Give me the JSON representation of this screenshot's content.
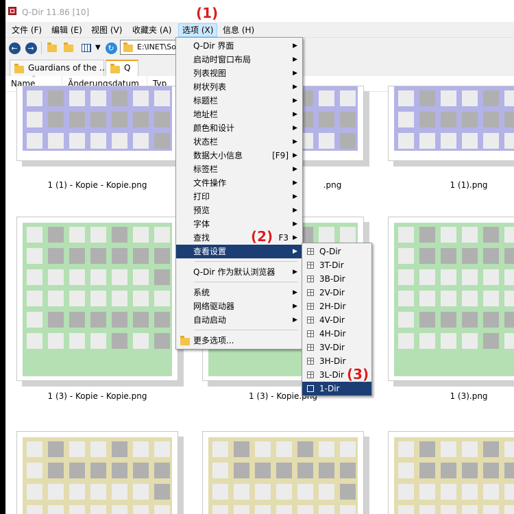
{
  "window": {
    "title": "Q-Dir 11.86 [10]"
  },
  "menubar": [
    {
      "label": "文件 (F)"
    },
    {
      "label": "编辑 (E)"
    },
    {
      "label": "视图 (V)"
    },
    {
      "label": "收藏夹 (A)"
    },
    {
      "label": "选项 (X)"
    },
    {
      "label": "信息 (H)"
    }
  ],
  "toolbar": {
    "address_value": "E:\\INET\\So"
  },
  "tabs": [
    {
      "label": "Guardians of the ..."
    },
    {
      "label": "Q"
    }
  ],
  "columns": [
    {
      "label": "Name"
    },
    {
      "label": "Änderungsdatum"
    },
    {
      "label": "Typ"
    }
  ],
  "files": [
    {
      "label": "1 (1) - Kopie - Kopie.png",
      "color": "#b3b3e8"
    },
    {
      "label": ".png",
      "color": "#b3b3e8"
    },
    {
      "label": "1 (1).png",
      "color": "#b3b3e8"
    },
    {
      "label": "1 (3) - Kopie - Kopie.png",
      "color": "#b4e0b4"
    },
    {
      "label": "1 (3) - Kopie.png",
      "color": "#b4e0b4"
    },
    {
      "label": "1 (3).png",
      "color": "#b4e0b4"
    },
    {
      "label": "",
      "color": "#e3dcae"
    },
    {
      "label": "",
      "color": "#e3dcae"
    },
    {
      "label": "",
      "color": "#e3dcae"
    }
  ],
  "options_menu": {
    "items": [
      {
        "label": "Q-Dir 界面",
        "shortcut": "",
        "submenu": true
      },
      {
        "label": "启动时窗口布局",
        "shortcut": "",
        "submenu": true
      },
      {
        "label": "列表视图",
        "shortcut": "",
        "submenu": true
      },
      {
        "label": "树状列表",
        "shortcut": "",
        "submenu": true
      },
      {
        "label": "标题栏",
        "shortcut": "",
        "submenu": true
      },
      {
        "label": "地址栏",
        "shortcut": "",
        "submenu": true
      },
      {
        "label": "颜色和设计",
        "shortcut": "",
        "submenu": true
      },
      {
        "label": "状态栏",
        "shortcut": "",
        "submenu": true
      },
      {
        "label": "数据大小信息",
        "shortcut": "[F9]",
        "submenu": true
      },
      {
        "label": "标签栏",
        "shortcut": "",
        "submenu": true
      },
      {
        "label": "文件操作",
        "shortcut": "",
        "submenu": true
      },
      {
        "label": "打印",
        "shortcut": "",
        "submenu": true
      },
      {
        "label": "预览",
        "shortcut": "",
        "submenu": true
      },
      {
        "label": "字体",
        "shortcut": "",
        "submenu": true
      },
      {
        "label": "查找",
        "shortcut": "F3",
        "submenu": true
      },
      {
        "label": "查看设置",
        "shortcut": "",
        "submenu": true,
        "highlighted": true
      },
      {
        "label": "Q-Dir 作为默认浏览器",
        "shortcut": "",
        "submenu": true
      },
      {
        "label": "系统",
        "shortcut": "",
        "submenu": true
      },
      {
        "label": "网络驱动器",
        "shortcut": "",
        "submenu": true
      },
      {
        "label": "自动启动",
        "shortcut": "",
        "submenu": true
      },
      {
        "label": "更多选项...",
        "shortcut": "",
        "submenu": false,
        "icon": "folder-icon"
      }
    ]
  },
  "view_submenu": {
    "items": [
      {
        "label": "Q-Dir"
      },
      {
        "label": "3T-Dir"
      },
      {
        "label": "3B-Dir"
      },
      {
        "label": "2V-Dir"
      },
      {
        "label": "2H-Dir"
      },
      {
        "label": "4V-Dir"
      },
      {
        "label": "4H-Dir"
      },
      {
        "label": "3V-Dir"
      },
      {
        "label": "3H-Dir"
      },
      {
        "label": "3L-Dir"
      },
      {
        "label": "1-Dir",
        "highlighted": true
      }
    ]
  },
  "annotations": [
    "(1)",
    "(2)",
    "(3)"
  ],
  "colors": {
    "menu_highlight": "#1b3e74",
    "annotation": "#d91e1e",
    "menubar_active": "#cce8ff"
  }
}
